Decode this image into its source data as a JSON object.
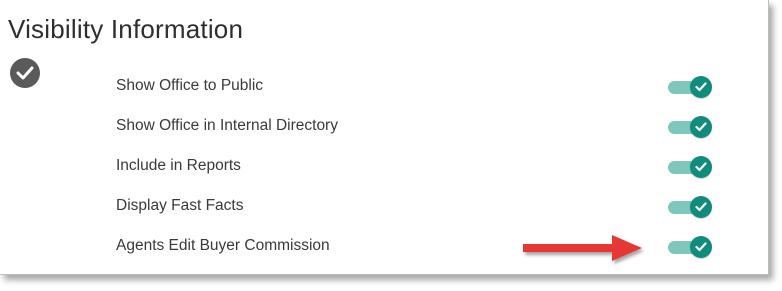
{
  "section": {
    "title": "Visibility Information"
  },
  "settings": [
    {
      "label": "Show Office to Public",
      "enabled": true
    },
    {
      "label": "Show Office in Internal Directory",
      "enabled": true
    },
    {
      "label": "Include in Reports",
      "enabled": true
    },
    {
      "label": "Display Fast Facts",
      "enabled": true
    },
    {
      "label": "Agents Edit Buyer Commission",
      "enabled": true
    }
  ],
  "colors": {
    "toggle_track": "#7fc6bd",
    "toggle_knob": "#0f8c7c",
    "section_check": "#5a5a5a",
    "annotation_arrow": "#e53935"
  },
  "icons": {
    "section": "check-circle-icon",
    "toggle": "check-icon",
    "annotation": "arrow-right-icon"
  }
}
